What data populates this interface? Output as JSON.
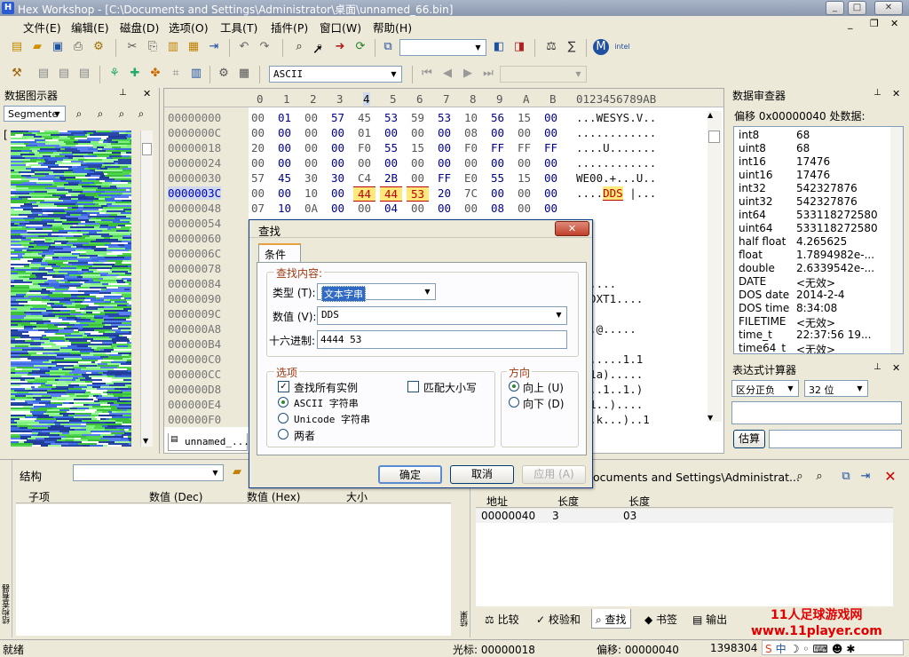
{
  "app": {
    "title": "Hex Workshop - [C:\\Documents and Settings\\Administrator\\桌面\\unnamed_66.bin]",
    "icon_letter": "H"
  },
  "menu": [
    "文件(E)",
    "编辑(E)",
    "磁盘(D)",
    "选项(O)",
    "工具(T)",
    "插件(P)",
    "窗口(W)",
    "帮助(H)"
  ],
  "toolbar": {
    "encoding": "ASCII"
  },
  "left_panel": {
    "title": "数据图示器",
    "combo": "Segmente",
    "bracket": "["
  },
  "hex": {
    "columns": [
      "0",
      "1",
      "2",
      "3",
      "4",
      "5",
      "6",
      "7",
      "8",
      "9",
      "A",
      "B"
    ],
    "ascii_header": "0123456789AB",
    "rows": [
      {
        "addr": "00000000",
        "bytes": [
          "00",
          "01",
          "00",
          "57",
          "45",
          "53",
          "59",
          "53",
          "10",
          "56",
          "15",
          "00"
        ],
        "ascii": "...WESYS.V.."
      },
      {
        "addr": "0000000C",
        "bytes": [
          "00",
          "00",
          "00",
          "00",
          "01",
          "00",
          "00",
          "00",
          "08",
          "00",
          "00",
          "00"
        ],
        "ascii": "............"
      },
      {
        "addr": "00000018",
        "bytes": [
          "20",
          "00",
          "00",
          "00",
          "F0",
          "55",
          "15",
          "00",
          "F0",
          "FF",
          "FF",
          "FF"
        ],
        "ascii": "....U......."
      },
      {
        "addr": "00000024",
        "bytes": [
          "00",
          "00",
          "00",
          "00",
          "00",
          "00",
          "00",
          "00",
          "00",
          "00",
          "00",
          "00"
        ],
        "ascii": "............"
      },
      {
        "addr": "00000030",
        "bytes": [
          "57",
          "45",
          "30",
          "30",
          "C4",
          "2B",
          "00",
          "FF",
          "E0",
          "55",
          "15",
          "00"
        ],
        "ascii": "WE00.+...U.."
      },
      {
        "addr": "0000003C",
        "bytes": [
          "00",
          "00",
          "10",
          "00",
          "44",
          "44",
          "53",
          "20",
          "7C",
          "00",
          "00",
          "00"
        ],
        "ascii": "....DDS |..."
      },
      {
        "addr": "00000048",
        "bytes": [
          "07",
          "10",
          "0A",
          "00",
          "00",
          "04",
          "00",
          "00",
          "00",
          "08",
          "00",
          "00"
        ],
        "ascii": ""
      },
      {
        "addr": "00000054",
        "bytes": [],
        "ascii": ""
      },
      {
        "addr": "00000060",
        "bytes": [],
        "ascii": ""
      },
      {
        "addr": "0000006C",
        "bytes": [],
        "ascii": ""
      },
      {
        "addr": "00000078",
        "bytes": [],
        "ascii": ""
      },
      {
        "addr": "00000084",
        "bytes": [],
        "ascii": "......"
      },
      {
        "addr": "00000090",
        "bytes": [],
        "ascii": "..DXT1...."
      },
      {
        "addr": "0000009C",
        "bytes": [],
        "ascii": ""
      },
      {
        "addr": "000000A8",
        "bytes": [],
        "ascii": "...@....."
      },
      {
        "addr": "000000B4",
        "bytes": [],
        "ascii": ""
      },
      {
        "addr": "000000C0",
        "bytes": [],
        "ascii": ")......1.1"
      },
      {
        "addr": "000000CC",
        "bytes": [],
        "ascii": "..1a)....."
      },
      {
        "addr": "000000D8",
        "bytes": [],
        "ascii": "....1..1.)"
      },
      {
        "addr": "000000E4",
        "bytes": [],
        "ascii": "..1..)...."
      },
      {
        "addr": "000000F0",
        "bytes": [],
        "ascii": ")..k...)..1"
      }
    ],
    "doc_tab": "unnamed_..."
  },
  "inspector": {
    "title": "数据审查器",
    "offset_label": "偏移 0x00000040 处数据:",
    "rows": [
      [
        "int8",
        "68"
      ],
      [
        "uint8",
        "68"
      ],
      [
        "int16",
        "17476"
      ],
      [
        "uint16",
        "17476"
      ],
      [
        "int32",
        "542327876"
      ],
      [
        "uint32",
        "542327876"
      ],
      [
        "int64",
        "533118272580"
      ],
      [
        "uint64",
        "533118272580"
      ],
      [
        "half float",
        "4.265625"
      ],
      [
        "float",
        "1.7894982e-..."
      ],
      [
        "double",
        "2.6339542e-..."
      ],
      [
        "DATE",
        "<无效>"
      ],
      [
        "DOS date",
        "2014-2-4"
      ],
      [
        "DOS time",
        "8:34:08"
      ],
      [
        "FILETIME",
        "<无效>"
      ],
      [
        "time_t",
        "22:37:56 19..."
      ],
      [
        "time64_t",
        "<无效>"
      ]
    ]
  },
  "calc": {
    "title": "表达式计算器",
    "mode": "区分正负",
    "bits": "32 位",
    "eval_button": "估算"
  },
  "structure": {
    "title": "结构",
    "columns": [
      "子项",
      "数值 (Dec)",
      "数值 (Hex)",
      "大小"
    ],
    "side_label": "结构查看器"
  },
  "results": {
    "path": "ocuments and Settings\\Administrat...",
    "columns": [
      "地址",
      "长度",
      "长度"
    ],
    "rows": [
      [
        "00000040",
        "3",
        "03"
      ]
    ],
    "tabs": [
      "比较",
      "校验和",
      "查找",
      "书签",
      "输出"
    ],
    "side_label": "结果"
  },
  "dialog": {
    "title": "查找",
    "tab": "条件",
    "group_find": "查找内容:",
    "type_label": "类型 (T):",
    "type_value": "文本字串",
    "value_label": "数值 (V):",
    "value_value": "DDS",
    "hex_label": "十六进制:",
    "hex_value": "4444 53",
    "options_title": "选项",
    "find_all": "查找所有实例",
    "match_case": "匹配大小写",
    "ascii": "ASCII 字符串",
    "unicode": "Unicode 字符串",
    "both": "两者",
    "dir_title": "方向",
    "up": "向上 (U)",
    "down": "向下 (D)",
    "ok": "确定",
    "cancel": "取消",
    "apply": "应用 (A)"
  },
  "status": {
    "ready": "就绪",
    "cursor": "光标: 00000018",
    "offset": "偏移: 00000040",
    "size": "1398304"
  },
  "watermark": {
    "line1": "11人足球游戏网",
    "line2": "www.11player.com"
  }
}
